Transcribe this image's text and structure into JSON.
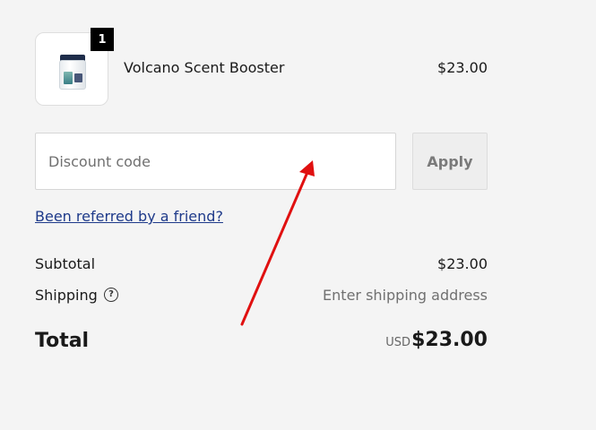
{
  "cart": {
    "items": [
      {
        "name": "Volcano Scent Booster",
        "price": "$23.00",
        "quantity": "1",
        "thumbnail_icon": "product-jar-icon"
      }
    ]
  },
  "discount": {
    "placeholder": "Discount code",
    "value": "",
    "apply_label": "Apply"
  },
  "referral": {
    "link_text": "Been referred by a friend?"
  },
  "summary": {
    "subtotal_label": "Subtotal",
    "subtotal_value": "$23.00",
    "shipping_label": "Shipping",
    "shipping_value": "Enter shipping address",
    "help_icon": "question-circle-icon",
    "help_glyph": "?",
    "total_label": "Total",
    "total_currency": "USD",
    "total_value": "$23.00"
  },
  "annotation": {
    "arrow_color": "#e01010",
    "icon": "red-arrow-annotation"
  }
}
